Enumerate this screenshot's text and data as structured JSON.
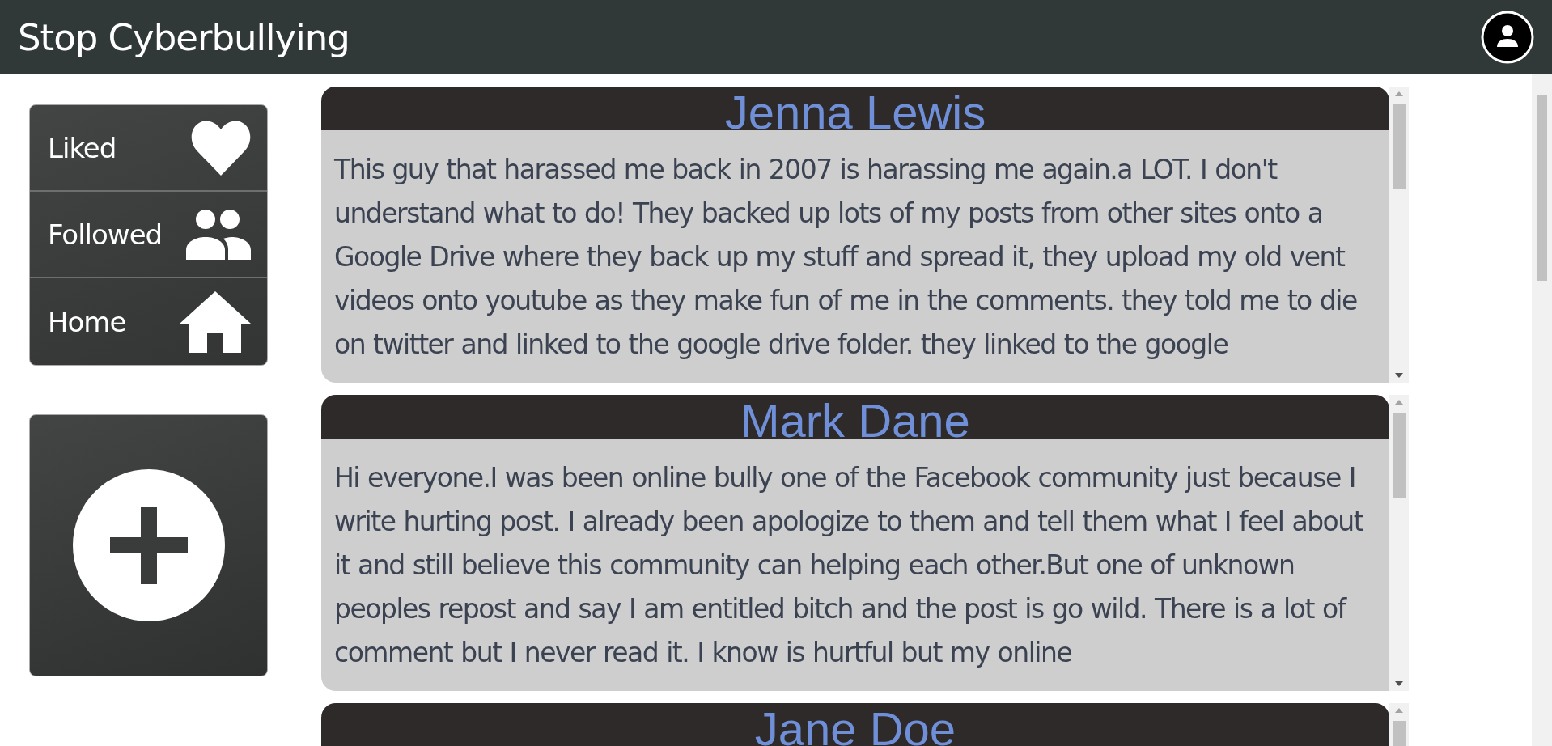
{
  "header": {
    "title": "Stop Cyberbullying"
  },
  "nav": [
    {
      "kind": "heart",
      "label": "Liked"
    },
    {
      "kind": "people",
      "label": "Followed"
    },
    {
      "kind": "home",
      "label": "Home"
    }
  ],
  "posts": [
    {
      "author": "Jenna Lewis",
      "text": "This guy that harassed me back in 2007 is harassing me again.a LOT. I don't understand what to do! They backed up lots of my posts from other sites onto a Google Drive where they back up my stuff and spread it, they upload my old vent videos onto youtube as they make fun of me in the comments. they told me to die on twitter and linked to the google drive folder. they linked to the google"
    },
    {
      "author": "Mark Dane",
      "text": "Hi everyone.I was been online bully one of the Facebook community just because I write hurting post. I already been apologize to them and tell them what I feel about it and still believe this community can helping each other.But one of unknown peoples repost and say I am entitled bitch and the post is go wild. There is a lot of comment but I never read it. I know is hurtful but my online"
    },
    {
      "author": "Jane Doe"
    }
  ]
}
